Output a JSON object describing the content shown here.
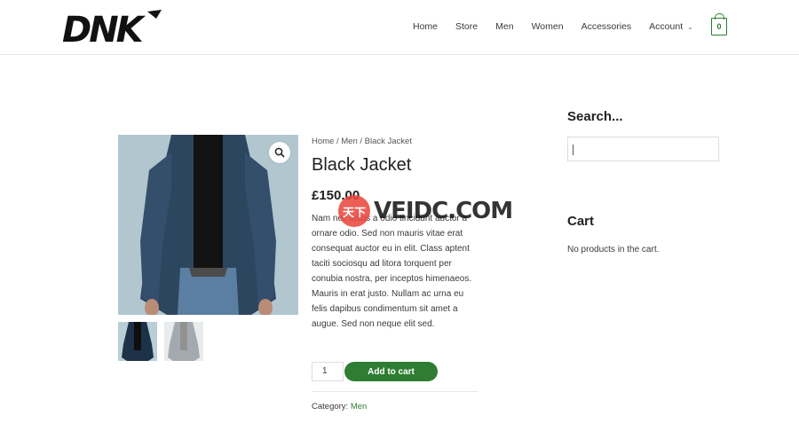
{
  "header": {
    "logo_text": "DNK",
    "nav": [
      {
        "label": "Home"
      },
      {
        "label": "Store"
      },
      {
        "label": "Men"
      },
      {
        "label": "Women"
      },
      {
        "label": "Accessories"
      },
      {
        "label": "Account"
      }
    ],
    "cart_count": "0"
  },
  "product": {
    "breadcrumb": "Home / Men / Black Jacket",
    "title": "Black Jacket",
    "price": "£150.00",
    "description": "Nam nec tellus a odio tincidunt auctor a ornare odio. Sed non mauris vitae erat consequat auctor eu in elit. Class aptent taciti sociosqu ad litora torquent per conubia nostra, per inceptos himenaeos. Mauris in erat justo. Nullam ac urna eu felis dapibus condimentum sit amet a augue. Sed non neque elit sed.",
    "quantity": "1",
    "add_to_cart_label": "Add to cart",
    "category_label": "Category:",
    "category_value": "Men"
  },
  "watermark": {
    "circle_text": "天下",
    "text": "VEIDC.COM"
  },
  "sidebar": {
    "search_title": "Search...",
    "search_value": "",
    "cart_title": "Cart",
    "cart_empty_text": "No products in the cart."
  },
  "colors": {
    "accent": "#2e7d32",
    "text": "#3a3a3a"
  },
  "icons": {
    "zoom": "magnifier-icon",
    "cart": "shopping-bag-icon",
    "dropdown": "chevron-down-icon"
  }
}
